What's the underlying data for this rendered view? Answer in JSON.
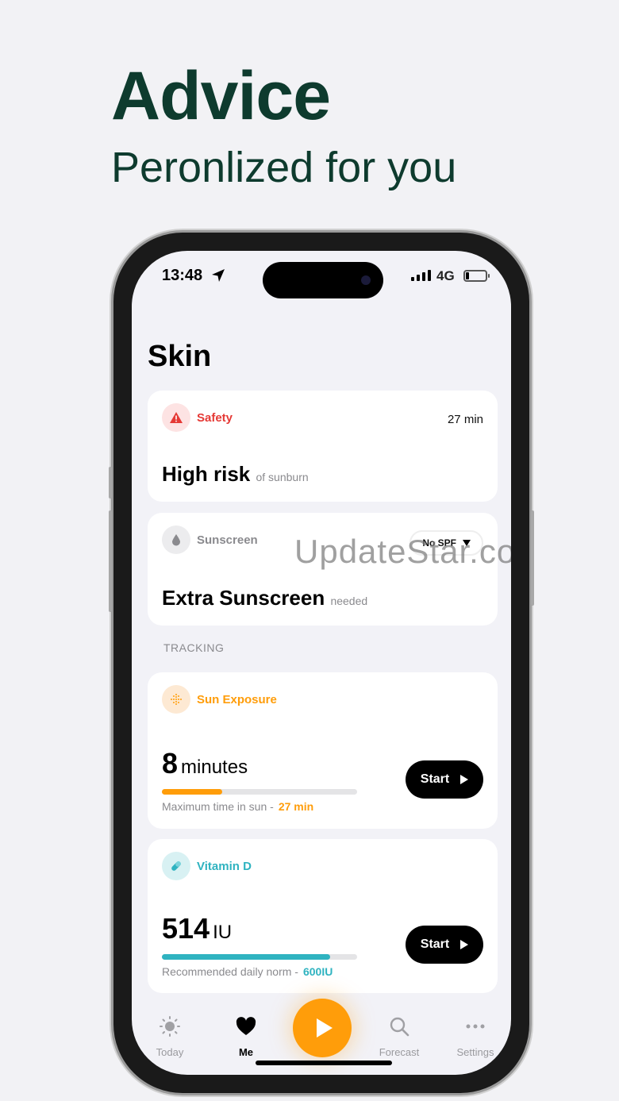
{
  "hero": {
    "title": "Advice",
    "subtitle": "Peronlized for you"
  },
  "status_bar": {
    "time": "13:48",
    "network": "4G",
    "battery_level": 0.1
  },
  "page": {
    "title": "Skin"
  },
  "safety_card": {
    "label": "Safety",
    "time": "27 min",
    "headline": "High risk",
    "detail": "of sunburn",
    "color": "#e53935"
  },
  "sunscreen_card": {
    "label": "Sunscreen",
    "spf_select": "No SPF",
    "headline": "Extra Sunscreen",
    "detail": "needed"
  },
  "tracking": {
    "section_label": "TRACKING",
    "sun_exposure": {
      "label": "Sun Exposure",
      "value": "8",
      "unit": "minutes",
      "progress": 0.31,
      "caption": "Maximum time in sun -",
      "caption_value": "27 min",
      "button": "Start",
      "color": "#ff9d0a"
    },
    "vitamin_d": {
      "label": "Vitamin D",
      "value": "514",
      "unit": "IU",
      "progress": 0.86,
      "caption": "Recommended daily norm -",
      "caption_value": "600IU",
      "button": "Start",
      "color": "#2fb3c0"
    }
  },
  "watermark": "UpdateStar.com",
  "tabs": [
    {
      "label": "Today",
      "icon": "sun-icon"
    },
    {
      "label": "Me",
      "icon": "heart-icon"
    },
    {
      "label": "Forecast",
      "icon": "search-icon"
    },
    {
      "label": "Settings",
      "icon": "more-icon"
    }
  ]
}
